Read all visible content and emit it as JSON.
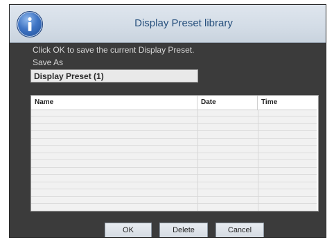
{
  "dialog": {
    "title": "Display Preset library",
    "icon": "info-icon",
    "instruction": "Click OK to save the current Display Preset.",
    "save_as_label": "Save As",
    "save_as_value": "Display Preset (1)"
  },
  "table": {
    "columns": [
      "Name",
      "Date",
      "Time"
    ],
    "rows": []
  },
  "buttons": {
    "ok": "OK",
    "delete": "Delete",
    "cancel": "Cancel"
  },
  "colors": {
    "title_text": "#27507d",
    "dialog_bg": "#3b3b3b",
    "title_bar": "#d3dce6"
  }
}
